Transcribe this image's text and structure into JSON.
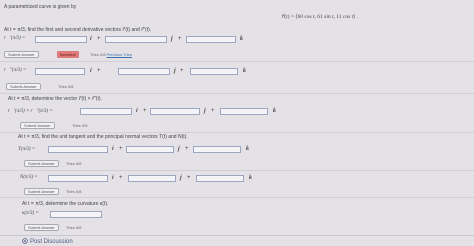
{
  "intro": "A parametrized curve is given by",
  "curve_eq": "r⃗(t) = ⟨60 cos t,  61 sin t,  11 cos t⟩ .",
  "parts": {
    "p1_prompt": "At t = π/3, find the first and second derivative vectors r⃗′(t) and r⃗″(t).",
    "p1_label1": "r⃗′(π/3) =",
    "p1_label2": "r⃗″(π/3) =",
    "p2_prompt": "At t = π/3, determine the vector r⃗′(t) × r⃗″(t).",
    "p2_label": "r⃗′(π/3) × r⃗″(π/3) =",
    "p3_prompt": "At t = π/3, find the unit tangent and the principal normal vectors T(t) and N(t).",
    "p3_label1": "T(π/3) =",
    "p3_label2": "N(π/3) =",
    "p4_prompt": "At t = π/3, determine the curvature κ(t).",
    "p4_label": "κ(π/3) ="
  },
  "units": {
    "i": "i⃗",
    "j": "j⃗",
    "k": "k⃗",
    "plus": "+"
  },
  "buttons": {
    "submit": "Submit Answer"
  },
  "status": {
    "incorrect": "Incorrect"
  },
  "tries": {
    "t1": "Tries 2/8",
    "t1_link": "Previous Tries",
    "t2": "Tries 0/8",
    "t3": "Tries 0/8",
    "t4": "Tries 0/8",
    "t5": "Tries 0/8",
    "t6": "Tries 0/8"
  },
  "footer": {
    "post_discussion": "Post Discussion"
  },
  "colors": {
    "incorrect_bg": "#e07a78",
    "link": "#3b6fb0",
    "background": "#e4e2e6"
  }
}
